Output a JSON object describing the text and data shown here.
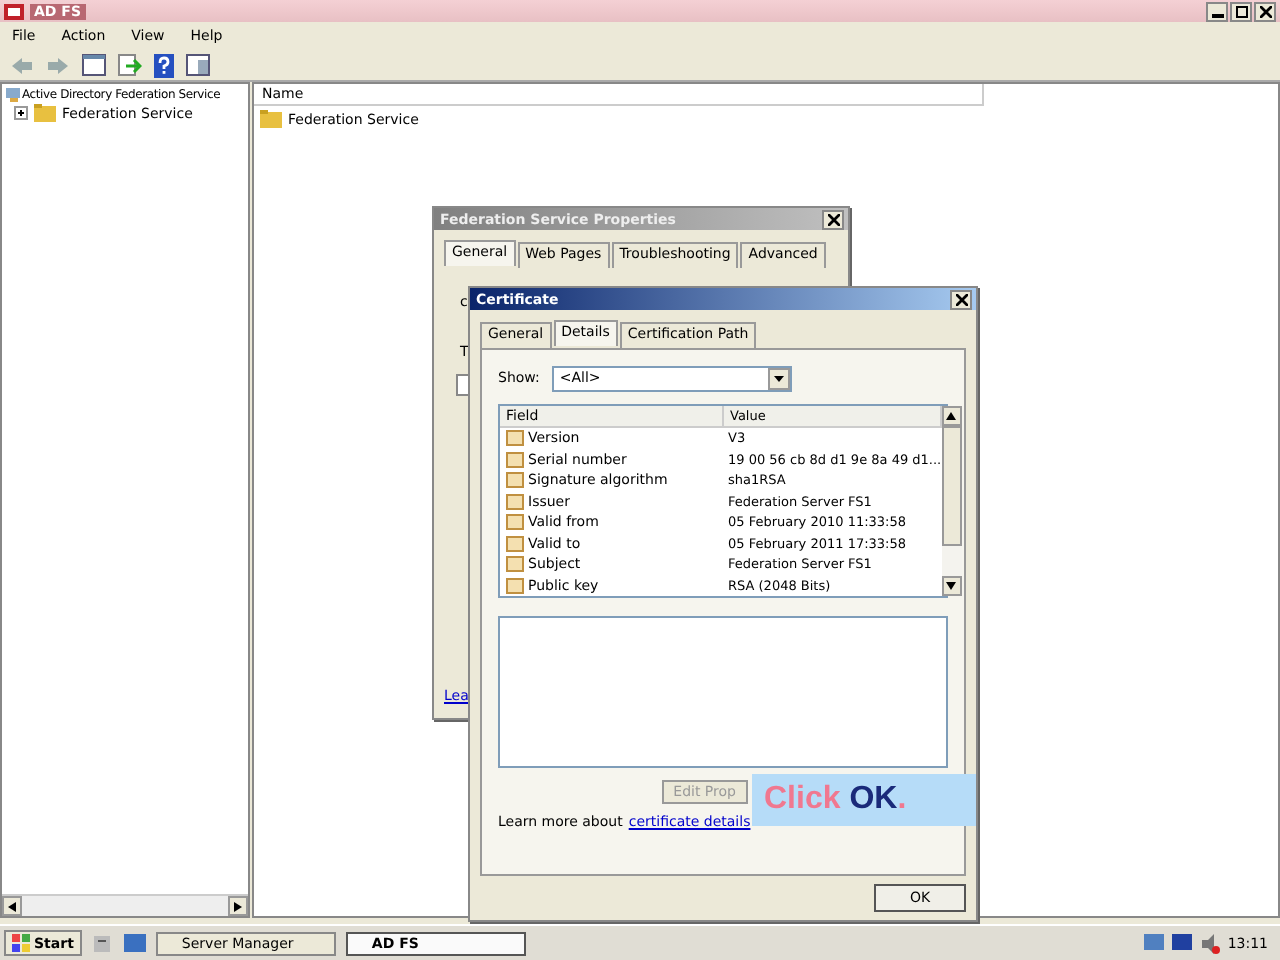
{
  "window": {
    "title": "AD FS"
  },
  "menu": [
    "File",
    "Action",
    "View",
    "Help"
  ],
  "tree": {
    "root": "Active Directory Federation Service",
    "children": [
      {
        "label": "Federation Service",
        "expanded": false
      }
    ]
  },
  "list": {
    "column": "Name",
    "items": [
      "Federation Service"
    ]
  },
  "properties": {
    "title": "Federation Service Properties",
    "tabs": [
      {
        "label": "General",
        "selected": true
      },
      {
        "label": "Web Pages",
        "selected": false
      },
      {
        "label": "Troubleshooting",
        "selected": false
      },
      {
        "label": "Advanced",
        "selected": false
      }
    ],
    "fragments": [
      "c",
      "T"
    ],
    "link": "Lea"
  },
  "certificate": {
    "title": "Certificate",
    "tabs": [
      {
        "label": "General",
        "selected": false
      },
      {
        "label": "Details",
        "selected": true
      },
      {
        "label": "Certification Path",
        "selected": false
      }
    ],
    "show_label": "Show:",
    "show_value": "<All>",
    "columns": [
      "Field",
      "Value"
    ],
    "rows": [
      {
        "field": "Version",
        "value": "V3"
      },
      {
        "field": "Serial number",
        "value": "19 00 56 cb 8d d1 9e 8a 49 d1..."
      },
      {
        "field": "Signature algorithm",
        "value": "sha1RSA"
      },
      {
        "field": "Issuer",
        "value": "Federation Server FS1"
      },
      {
        "field": "Valid from",
        "value": "05 February 2010 11:33:58"
      },
      {
        "field": "Valid to",
        "value": "05 February 2011 17:33:58"
      },
      {
        "field": "Subject",
        "value": "Federation Server FS1"
      },
      {
        "field": "Public key",
        "value": "RSA (2048 Bits)"
      }
    ],
    "edit_button": "Edit Prop",
    "learn_text": "Learn more about",
    "learn_link": "certificate details",
    "ok": "OK"
  },
  "callout": [
    {
      "text": "Click",
      "kind": "plain"
    },
    {
      "text": " OK",
      "kind": "emph"
    },
    {
      "text": ".",
      "kind": "plain"
    }
  ],
  "taskbar": {
    "start": "Start",
    "tasks": [
      {
        "label": "Server Manager",
        "selected": false
      },
      {
        "label": "AD FS",
        "selected": true
      }
    ],
    "clock": "13:11"
  }
}
